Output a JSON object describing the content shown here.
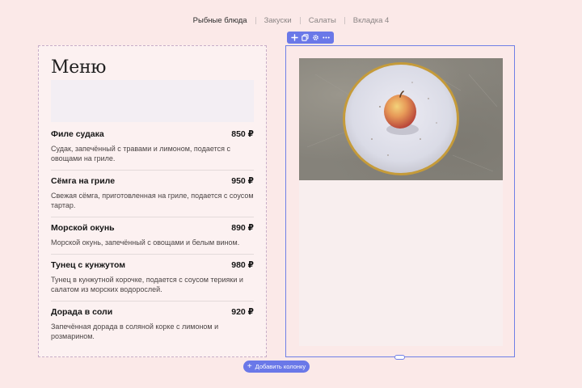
{
  "tabs": [
    {
      "label": "Рыбные блюда",
      "active": true
    },
    {
      "label": "Закуски",
      "active": false
    },
    {
      "label": "Салаты",
      "active": false
    },
    {
      "label": "Вкладка 4",
      "active": false
    }
  ],
  "menu": {
    "title": "Меню",
    "items": [
      {
        "name": "Филе судака",
        "price": "850 ₽",
        "description": "Судак, запечённый с травами и лимоном, подается с овощами на гриле."
      },
      {
        "name": "Сёмга на гриле",
        "price": "950 ₽",
        "description": "Свежая сёмга, приготовленная на гриле, подается с соусом тартар."
      },
      {
        "name": "Морской окунь",
        "price": "890 ₽",
        "description": "Морской окунь, запечённый с овощами и белым вином."
      },
      {
        "name": "Тунец с кунжутом",
        "price": "980 ₽",
        "description": "Тунец в кунжутной корочке, подается с соусом терияки и салатом из морских водорослей."
      },
      {
        "name": "Дорада в соли",
        "price": "920 ₽",
        "description": "Запечённая дорада в соляной корке с лимоном и розмарином."
      }
    ]
  },
  "toolbar": {
    "icons": [
      "plus-icon",
      "duplicate-icon",
      "gear-icon",
      "more-icon"
    ]
  },
  "add_column_label": "Добавить колонку",
  "colors": {
    "accent": "#6a78e8",
    "background": "#fbe9e8"
  }
}
